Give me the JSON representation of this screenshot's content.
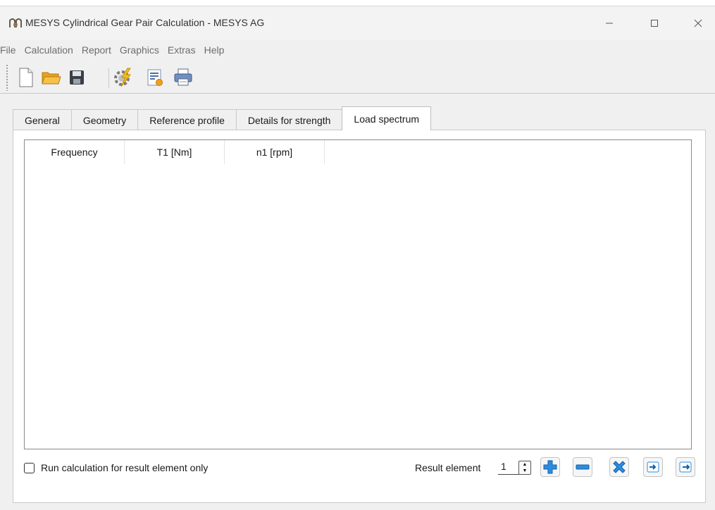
{
  "window": {
    "title": "MESYS Cylindrical Gear Pair Calculation - MESYS AG",
    "app_icon": "mesys-logo-icon",
    "controls": [
      "minimize-icon",
      "maximize-icon",
      "close-icon"
    ]
  },
  "menu": {
    "items": [
      {
        "label": "File"
      },
      {
        "label": "Calculation"
      },
      {
        "label": "Report"
      },
      {
        "label": "Graphics"
      },
      {
        "label": "Extras"
      },
      {
        "label": "Help"
      }
    ]
  },
  "toolbar": {
    "buttons": [
      "new-file-icon",
      "open-folder-icon",
      "save-icon",
      "calculate-icon",
      "report-icon",
      "print-icon"
    ]
  },
  "tabs": [
    {
      "label": "General",
      "active": false
    },
    {
      "label": "Geometry",
      "active": false
    },
    {
      "label": "Reference profile",
      "active": false
    },
    {
      "label": "Details for strength",
      "active": false
    },
    {
      "label": "Load spectrum",
      "active": true
    }
  ],
  "load_spectrum": {
    "columns": [
      "Frequency",
      "T1 [Nm]",
      "n1 [rpm]"
    ],
    "rows": [],
    "run_for_result_only": {
      "label": "Run calculation for result element only",
      "checked": false
    },
    "result_element": {
      "label": "Result element",
      "value": "1"
    },
    "actions": [
      "add-row-icon",
      "remove-row-icon",
      "delete-all-icon",
      "import-icon",
      "export-icon"
    ]
  },
  "colors": {
    "accent": "#1e7fd6",
    "window_bg": "#f0f0f0",
    "panel_bg": "#ffffff"
  }
}
